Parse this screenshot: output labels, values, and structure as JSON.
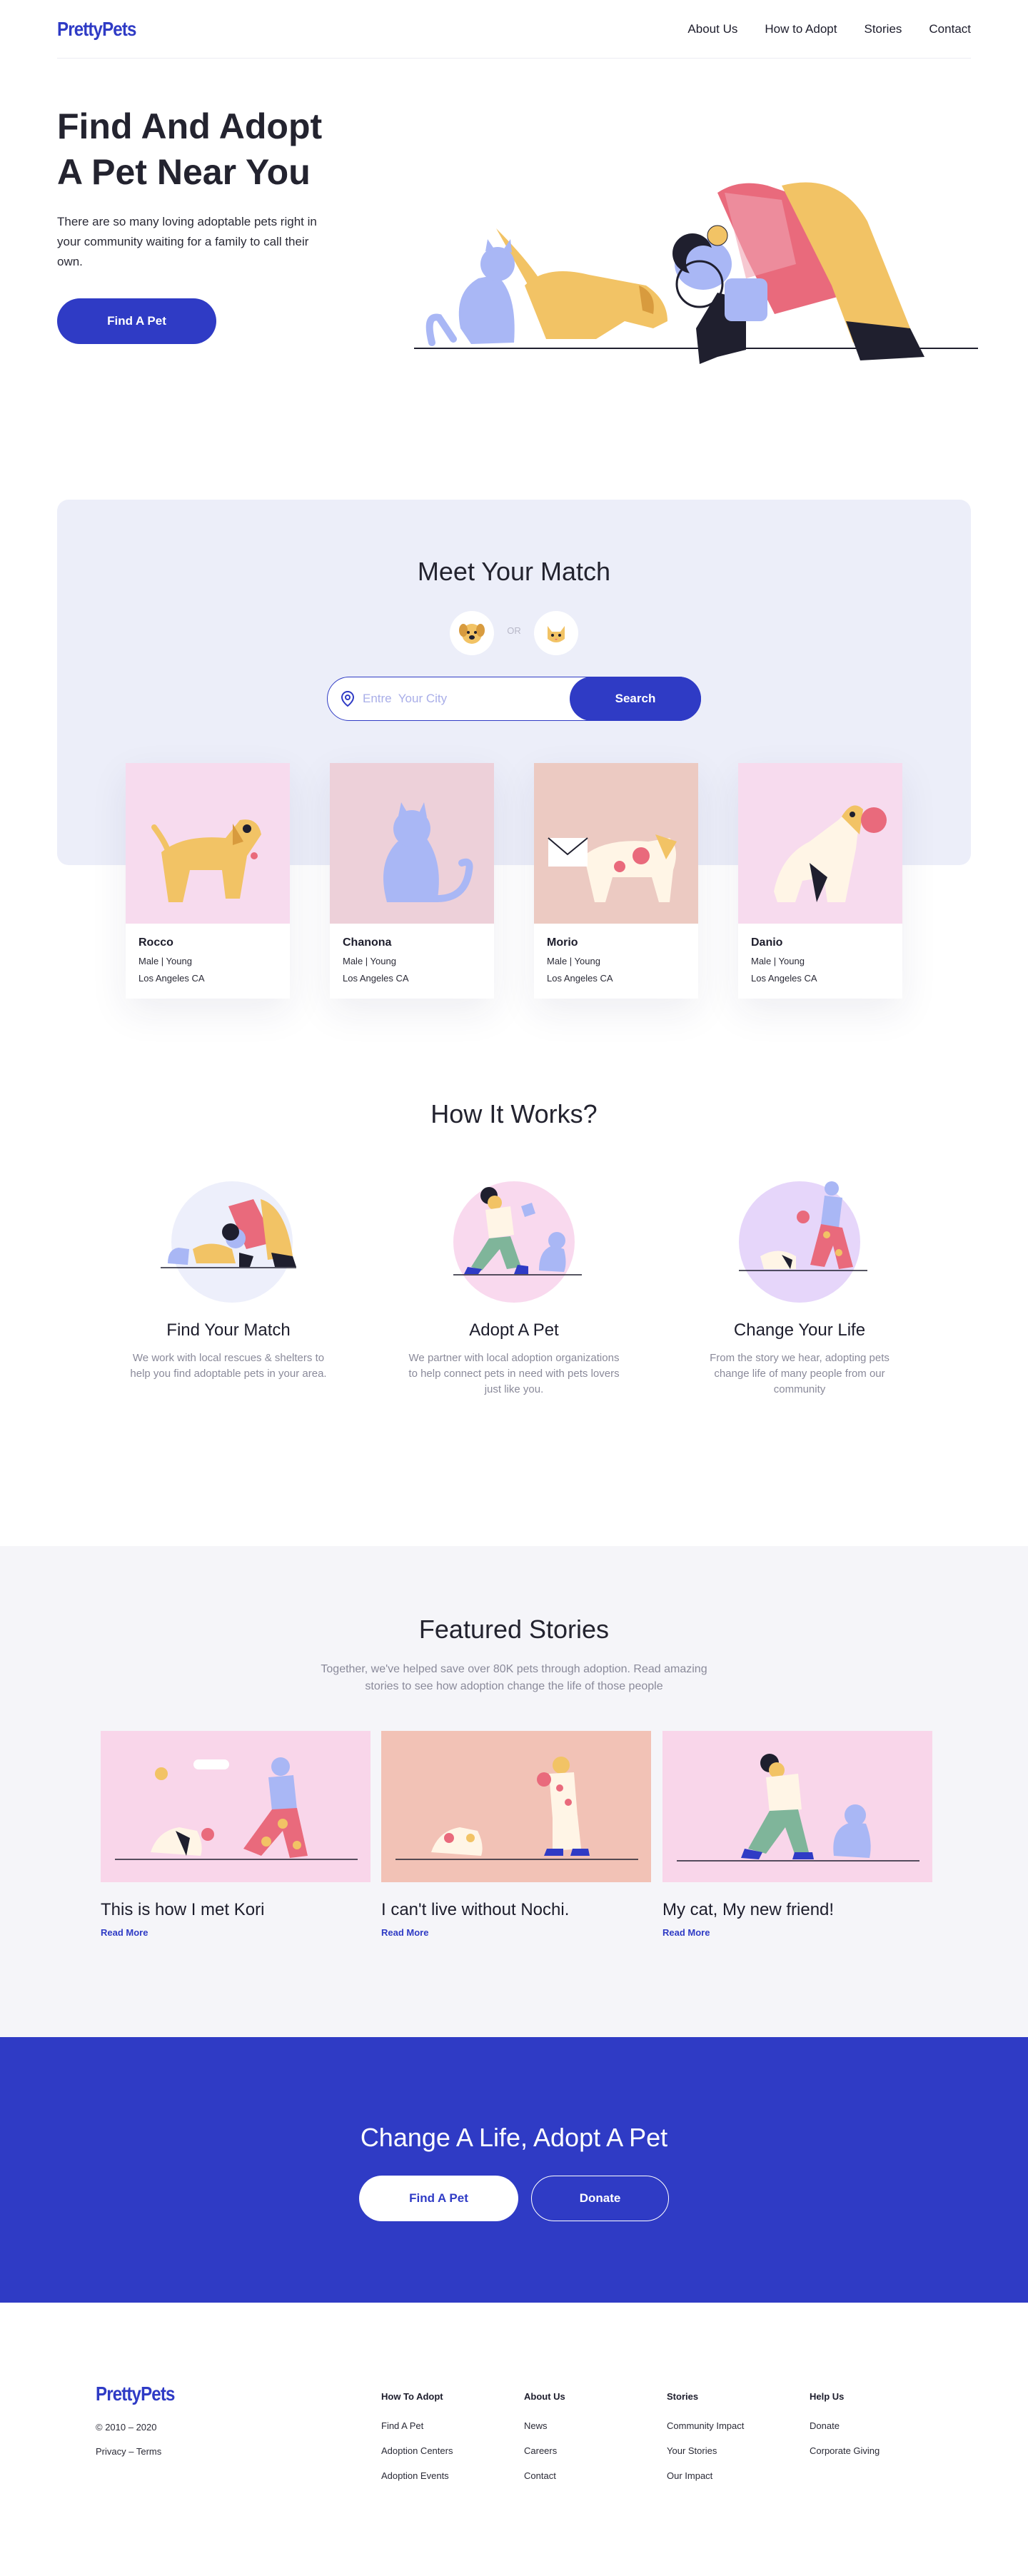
{
  "brand": {
    "name": "PrettyPets",
    "accent": "#2f3bc5"
  },
  "nav": {
    "items": [
      "About Us",
      "How to  Adopt",
      "Stories",
      "Contact"
    ]
  },
  "hero": {
    "title_line1": "Find And Adopt",
    "title_line2": "A Pet Near You",
    "description": "There are so many loving adoptable pets right in your community waiting for a family to call their own.",
    "button": "Find A Pet"
  },
  "match": {
    "title": "Meet Your Match",
    "toggle": {
      "dog_icon": "dog-face-icon",
      "cat_icon": "cat-face-icon",
      "or": "OR"
    },
    "search": {
      "placeholder": "Entre  Your City",
      "value": "",
      "icon": "location-pin-icon",
      "button": "Search"
    },
    "pets": [
      {
        "name": "Rocco",
        "meta": "Male |  Young",
        "location": "Los Angeles CA",
        "bg": "#f7dbee"
      },
      {
        "name": "Chanona",
        "meta": "Male |  Young",
        "location": "Los Angeles CA",
        "bg": "#edd0d9"
      },
      {
        "name": "Morio",
        "meta": "Male |  Young",
        "location": "Los Angeles CA",
        "bg": "#eccac2"
      },
      {
        "name": "Danio",
        "meta": "Male |  Young",
        "location": "Los Angeles CA",
        "bg": "#f7dbee"
      }
    ]
  },
  "how": {
    "title": "How It Works?",
    "steps": [
      {
        "title": "Find Your Match",
        "text": "We work with local rescues & shelters to help you find adoptable pets in your area."
      },
      {
        "title": "Adopt A Pet",
        "text": "We partner with local adoption organizations to help connect pets in need with pets lovers just like you."
      },
      {
        "title": "Change Your Life",
        "text": "From the story we hear, adopting pets change life of many people from our community"
      }
    ]
  },
  "stories": {
    "title": "Featured Stories",
    "subtitle": "Together, we've helped save over 80K pets through adoption.  Read amazing stories to see how adoption change the life of those people",
    "items": [
      {
        "title": "This is how I met Kori",
        "link": "Read More"
      },
      {
        "title": "I can't live without Nochi.",
        "link": "Read More"
      },
      {
        "title": "My cat, My new friend!",
        "link": "Read More"
      }
    ]
  },
  "cta": {
    "title": "Change A Life, Adopt A Pet",
    "find": "Find A Pet",
    "donate": "Donate"
  },
  "footer": {
    "brand": "PrettyPets",
    "copyright": "© 2010 – 2020",
    "legal": "Privacy – Terms",
    "columns": [
      {
        "title": "How To  Adopt",
        "links": [
          "Find A Pet",
          "Adoption Centers",
          "Adoption Events"
        ]
      },
      {
        "title": "About Us",
        "links": [
          "News",
          "Careers",
          "Contact"
        ]
      },
      {
        "title": "Stories",
        "links": [
          "Community Impact",
          "Your Stories",
          "Our Impact"
        ]
      },
      {
        "title": "Help Us",
        "links": [
          "Donate",
          "Corporate Giving"
        ]
      }
    ]
  }
}
